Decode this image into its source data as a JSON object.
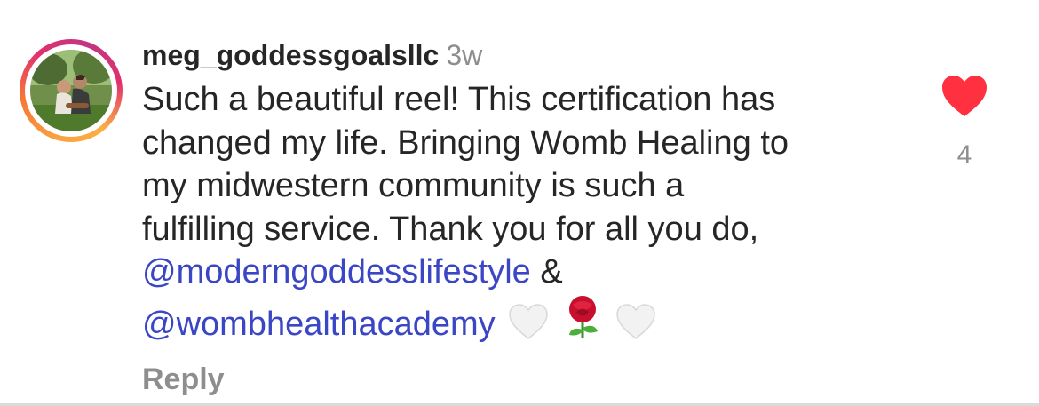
{
  "comment": {
    "username": "meg_goddessgoalsllc",
    "time": "3w",
    "text_lines": [
      "Such a beautiful reel! This certification has",
      "changed my life. Bringing Womb Healing to",
      "my midwestern community is such a",
      "fulfilling service. Thank you for all you do,"
    ],
    "mention_1": "@moderngoddesslifestyle",
    "amp": "&",
    "mention_2": "@wombhealthacademy",
    "emojis": [
      "white-heart-icon",
      "rose-icon",
      "white-heart-icon"
    ],
    "reply_label": "Reply"
  },
  "likes": {
    "count": "4",
    "icon": "heart-icon",
    "color": "#ff3040"
  },
  "colors": {
    "mention": "#3b46c4",
    "muted": "#8e8e8e",
    "text": "#262626"
  }
}
